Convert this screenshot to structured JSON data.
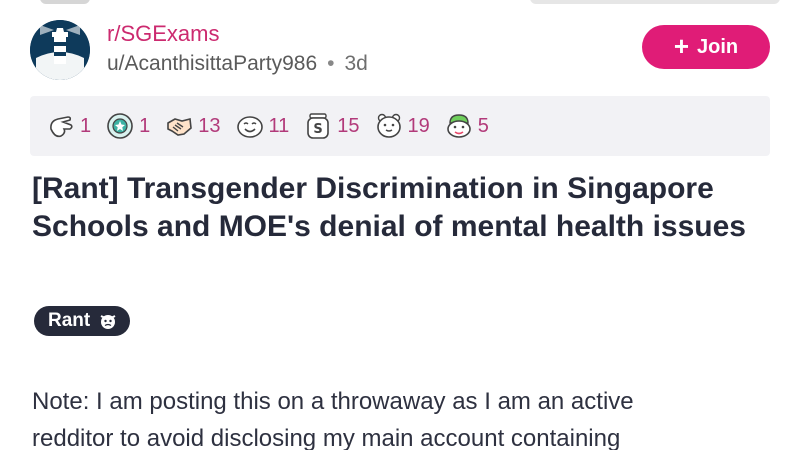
{
  "post": {
    "subreddit": "r/SGExams",
    "author": "u/AcanthisittaParty986",
    "separator": "•",
    "age": "3d",
    "join_label": "Join",
    "join_plus": "+",
    "title": "[Rant] Transgender Discrimination in Singapore Schools and MOE's denial of mental health issues",
    "flair": "Rant",
    "body_line1": "Note: I am posting this on a throwaway as I am an active",
    "body_line2": "redditor to avoid disclosing my main account containing"
  },
  "awards": [
    {
      "icon": "pointing-hand-award-icon",
      "count": "1"
    },
    {
      "icon": "medal-award-icon",
      "count": "1"
    },
    {
      "icon": "handshake-award-icon",
      "count": "13"
    },
    {
      "icon": "smile-face-award-icon",
      "count": "11"
    },
    {
      "icon": "dollar-jar-award-icon",
      "count": "15"
    },
    {
      "icon": "bear-hug-award-icon",
      "count": "19"
    },
    {
      "icon": "frog-award-icon",
      "count": "5"
    }
  ],
  "colors": {
    "subreddit": "#cc2a6f",
    "join_button": "#e01c77",
    "award_count": "#b23a7a",
    "flair_bg": "#262a3a",
    "title": "#262a3a",
    "awards_bg": "#f2f2f5"
  }
}
